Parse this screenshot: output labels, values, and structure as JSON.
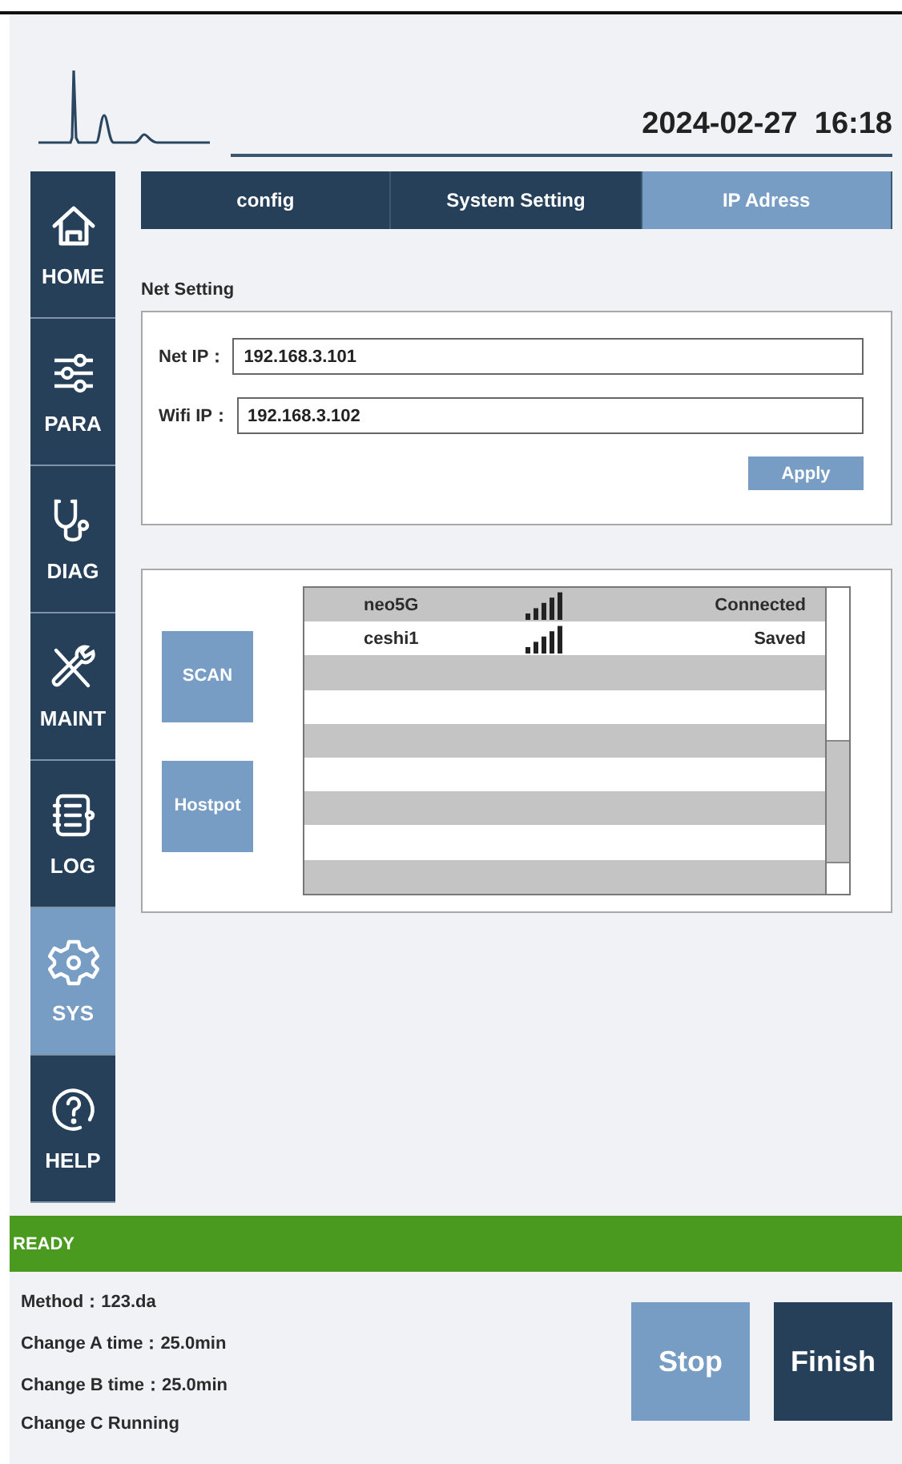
{
  "header": {
    "datetime": "2024-02-27  16:18"
  },
  "sidebar": {
    "items": [
      {
        "label": "HOME",
        "selected": false
      },
      {
        "label": "PARA",
        "selected": false
      },
      {
        "label": "DIAG",
        "selected": false
      },
      {
        "label": "MAINT",
        "selected": false
      },
      {
        "label": "LOG",
        "selected": false
      },
      {
        "label": "SYS",
        "selected": true
      },
      {
        "label": "HELP",
        "selected": false
      }
    ]
  },
  "tabs": [
    {
      "label": "config",
      "selected": false
    },
    {
      "label": "System Setting",
      "selected": false
    },
    {
      "label": "IP Adress",
      "selected": true
    }
  ],
  "net_setting": {
    "title": "Net Setting",
    "fields": [
      {
        "label": "Net IP：",
        "value": "192.168.3.101"
      },
      {
        "label": "Wifi IP：",
        "value": "192.168.3.102"
      }
    ],
    "apply_button": "Apply"
  },
  "wifi": {
    "buttons": [
      "SCAN",
      "Hostpot"
    ],
    "networks": [
      {
        "name": "neo5G",
        "status": "Connected"
      },
      {
        "name": "ceshi1",
        "status": "Saved"
      }
    ]
  },
  "status_bar": {
    "text": "READY"
  },
  "run_info": [
    "Method：123.da",
    "Change A time：25.0min",
    "Change B time：25.0min",
    "Change C Running"
  ],
  "actions": [
    {
      "label": "Stop",
      "kind": "light"
    },
    {
      "label": "Finish",
      "kind": "dark"
    }
  ]
}
